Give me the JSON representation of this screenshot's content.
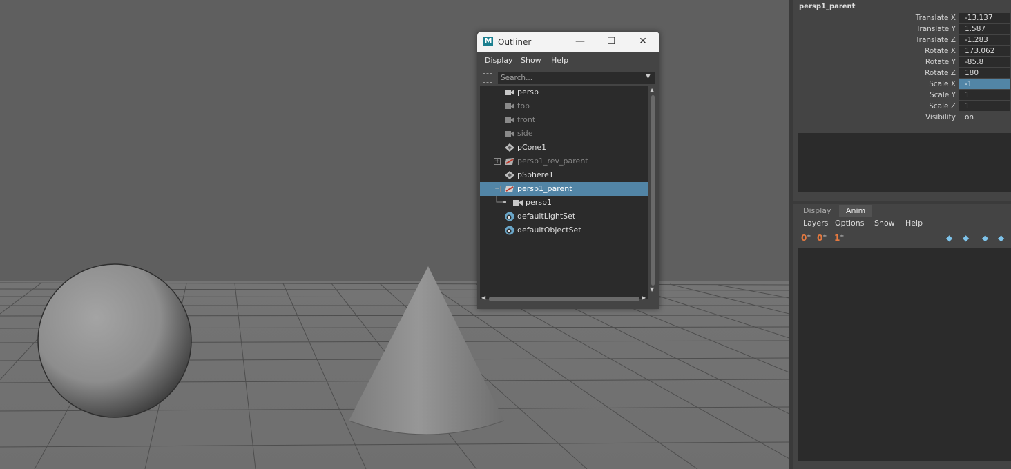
{
  "outliner": {
    "title": "Outliner",
    "menu": [
      "Display",
      "Show",
      "Help"
    ],
    "search_placeholder": "Search...",
    "items": [
      {
        "name": "persp",
        "icon": "camera-icon",
        "dim": false
      },
      {
        "name": "top",
        "icon": "camera-icon",
        "dim": true
      },
      {
        "name": "front",
        "icon": "camera-icon",
        "dim": true
      },
      {
        "name": "side",
        "icon": "camera-icon",
        "dim": true
      },
      {
        "name": "pCone1",
        "icon": "mesh-icon",
        "dim": false
      },
      {
        "name": "persp1_rev_parent",
        "icon": "transform-icon",
        "dim": true
      },
      {
        "name": "pSphere1",
        "icon": "mesh-icon",
        "dim": false
      },
      {
        "name": "persp1_parent",
        "icon": "transform-icon",
        "dim": false
      },
      {
        "name": "persp1",
        "icon": "camera-icon",
        "dim": false
      },
      {
        "name": "defaultLightSet",
        "icon": "set-icon",
        "dim": false
      },
      {
        "name": "defaultObjectSet",
        "icon": "set-icon",
        "dim": false
      }
    ]
  },
  "channel_box": {
    "object_name": "persp1_parent",
    "attributes": [
      {
        "label": "Translate X",
        "value": "-13.137"
      },
      {
        "label": "Translate Y",
        "value": "1.587"
      },
      {
        "label": "Translate Z",
        "value": "-1.283"
      },
      {
        "label": "Rotate X",
        "value": "173.062"
      },
      {
        "label": "Rotate Y",
        "value": "-85.8"
      },
      {
        "label": "Rotate Z",
        "value": "180"
      },
      {
        "label": "Scale X",
        "value": "-1"
      },
      {
        "label": "Scale Y",
        "value": "1"
      },
      {
        "label": "Scale Z",
        "value": "1"
      },
      {
        "label": "Visibility",
        "value": "on"
      }
    ]
  },
  "layer_editor": {
    "tabs": [
      "Display",
      "Anim"
    ],
    "menu": [
      "Layers",
      "Options",
      "Show",
      "Help"
    ],
    "tool_labels": [
      "0",
      "0",
      "1"
    ]
  },
  "colors": {
    "selection": "#5285a6",
    "viewport_bg": "#5d5d5d",
    "accent_orange": "#e6793f"
  }
}
